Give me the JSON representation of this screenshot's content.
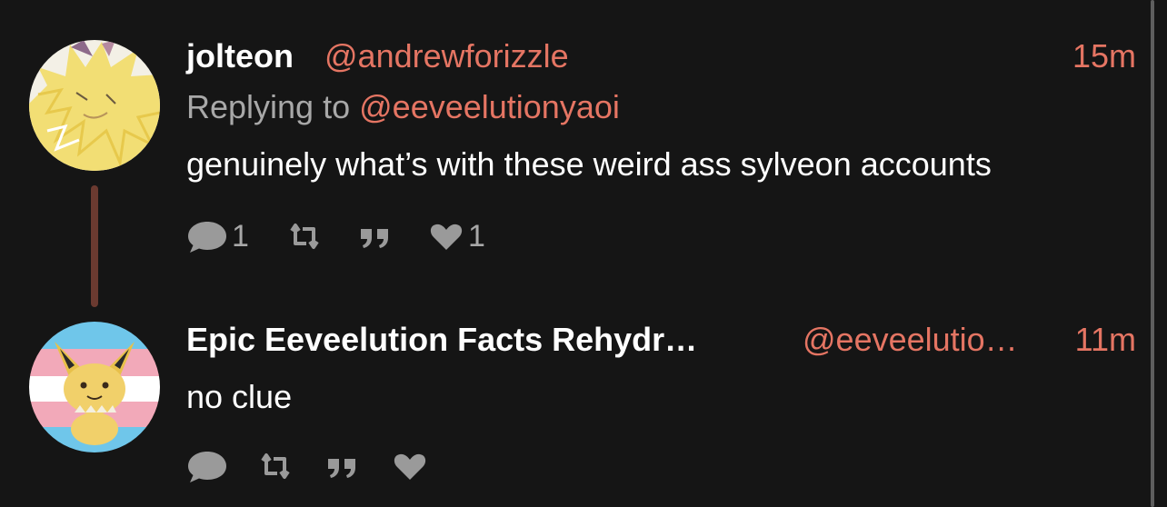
{
  "posts": [
    {
      "display_name": "jolteon",
      "handle": "@andrewforizzle",
      "time": "15m",
      "replying_prefix": "Replying to",
      "replying_to": "@eeveelutionyaoi",
      "text": "genuinely what’s with these weird ass sylveon accounts",
      "reply_count": "1",
      "repost_count": "",
      "quote_count": "",
      "like_count": "1",
      "avatar": "jolteon-avatar"
    },
    {
      "display_name": "Epic Eeveelution Facts Rehydr…",
      "handle": "@eeveelutio…",
      "time": "11m",
      "text": "no clue",
      "reply_count": "",
      "repost_count": "",
      "quote_count": "",
      "like_count": "",
      "avatar": "jolteon-trans-flag-avatar"
    }
  ],
  "icons": {
    "reply": "speech-bubble-icon",
    "repost": "repost-arrows-icon",
    "quote": "quote-icon",
    "like": "heart-icon"
  },
  "colors": {
    "background": "#151515",
    "accent": "#e57563",
    "text": "#ffffff",
    "muted": "#a8a8a8",
    "thread_line": "#6b3a30"
  }
}
